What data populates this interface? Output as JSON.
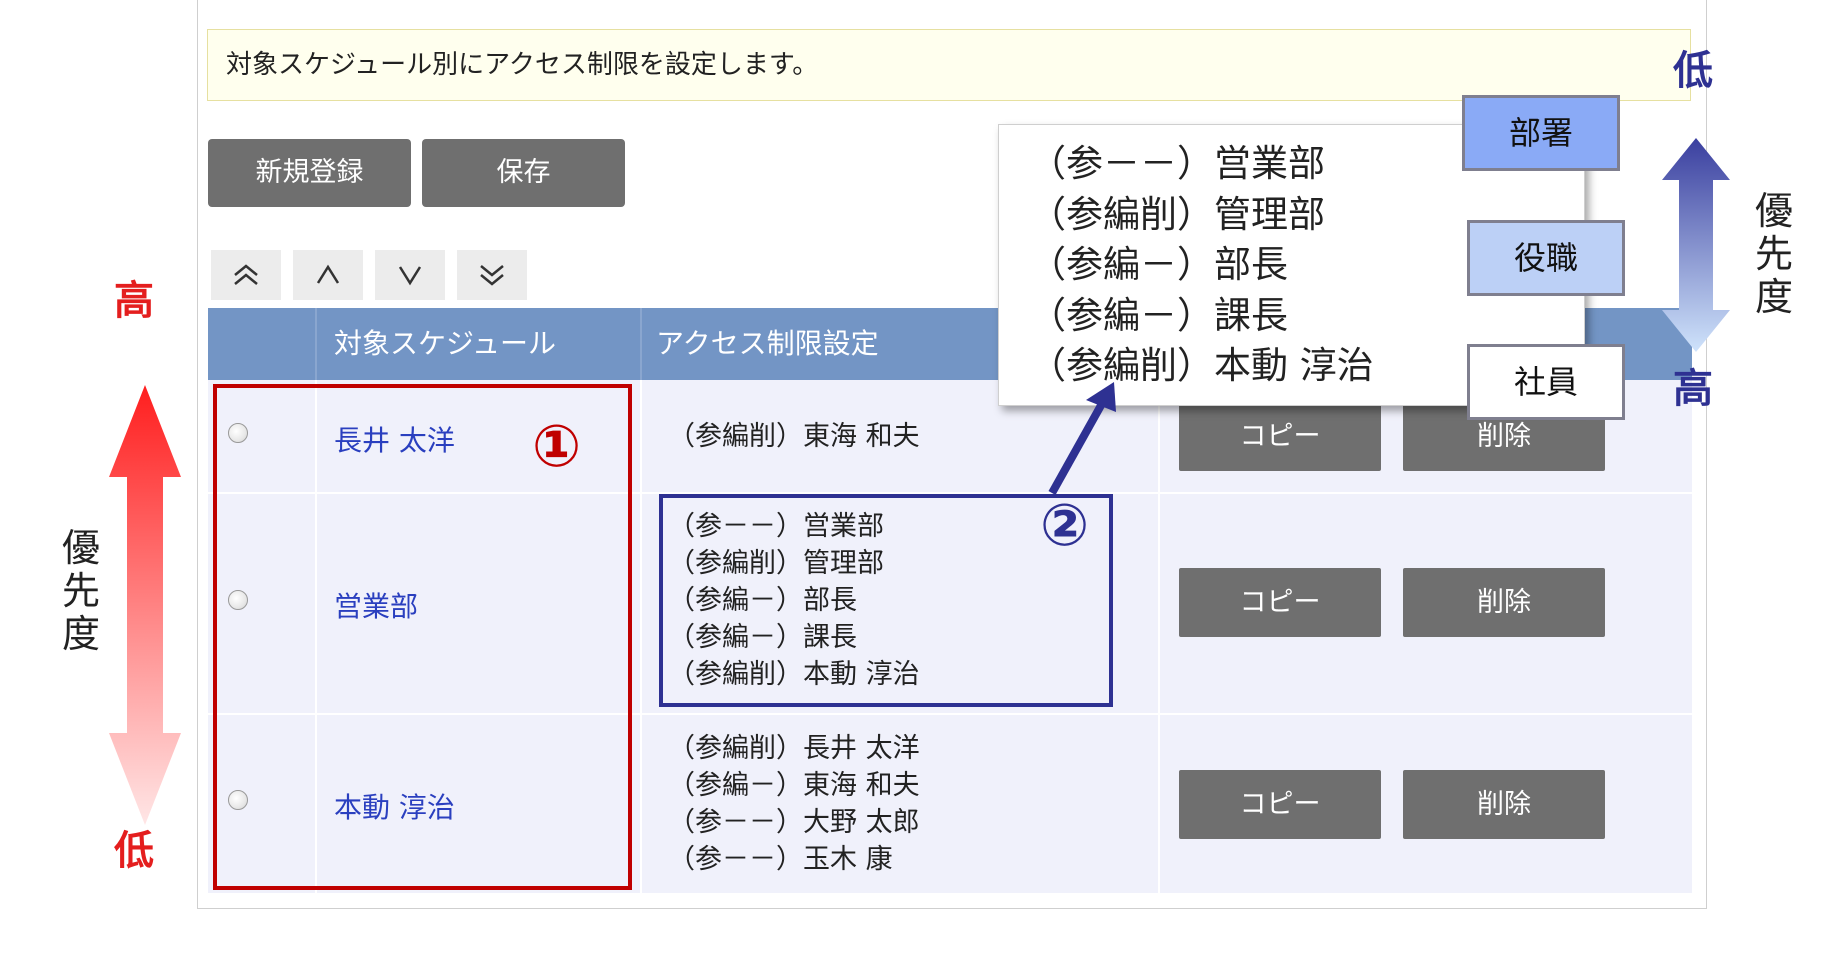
{
  "notice": "対象スケジュール別にアクセス制限を設定します。",
  "toolbar": {
    "new_label": "新規登録",
    "save_label": "保存"
  },
  "sort_buttons": [
    "move-top",
    "move-up",
    "move-down",
    "move-bottom"
  ],
  "table": {
    "headers": [
      "",
      "対象スケジュール",
      "アクセス制限設定",
      ""
    ],
    "rows": [
      {
        "name": "長井 太洋",
        "access": [
          "（参編削）東海 和夫"
        ],
        "copy": "コピー",
        "delete": "削除"
      },
      {
        "name": "営業部",
        "access": [
          "（参－－）営業部",
          "（参編削）管理部",
          "（参編－）部長",
          "（参編－）課長",
          "（参編削）本動 淳治"
        ],
        "copy": "コピー",
        "delete": "削除"
      },
      {
        "name": "本動 淳治",
        "access": [
          "（参編削）長井 太洋",
          "（参編－）東海 和夫",
          "（参－－）大野 太郎",
          "（参－－）玉木 康"
        ],
        "copy": "コピー",
        "delete": "削除"
      }
    ]
  },
  "popup": {
    "lines": [
      "（参－－）営業部",
      "（参編削）管理部",
      "（参編－）部長",
      "（参編－）課長",
      "（参編削）本動 淳治"
    ]
  },
  "annotations": {
    "marker1": "①",
    "marker2": "②",
    "left": {
      "high": "高",
      "low": "低",
      "label": [
        "優",
        "先",
        "度"
      ]
    },
    "right": {
      "low": "低",
      "high": "高",
      "label": [
        "優",
        "先",
        "度"
      ]
    },
    "tags": {
      "dept": "部署",
      "role": "役職",
      "emp": "社員"
    }
  },
  "colors": {
    "header": "#7395c5",
    "annot_red": "#c00000",
    "annot_navy": "#2e3192",
    "link": "#2a3fbf"
  }
}
